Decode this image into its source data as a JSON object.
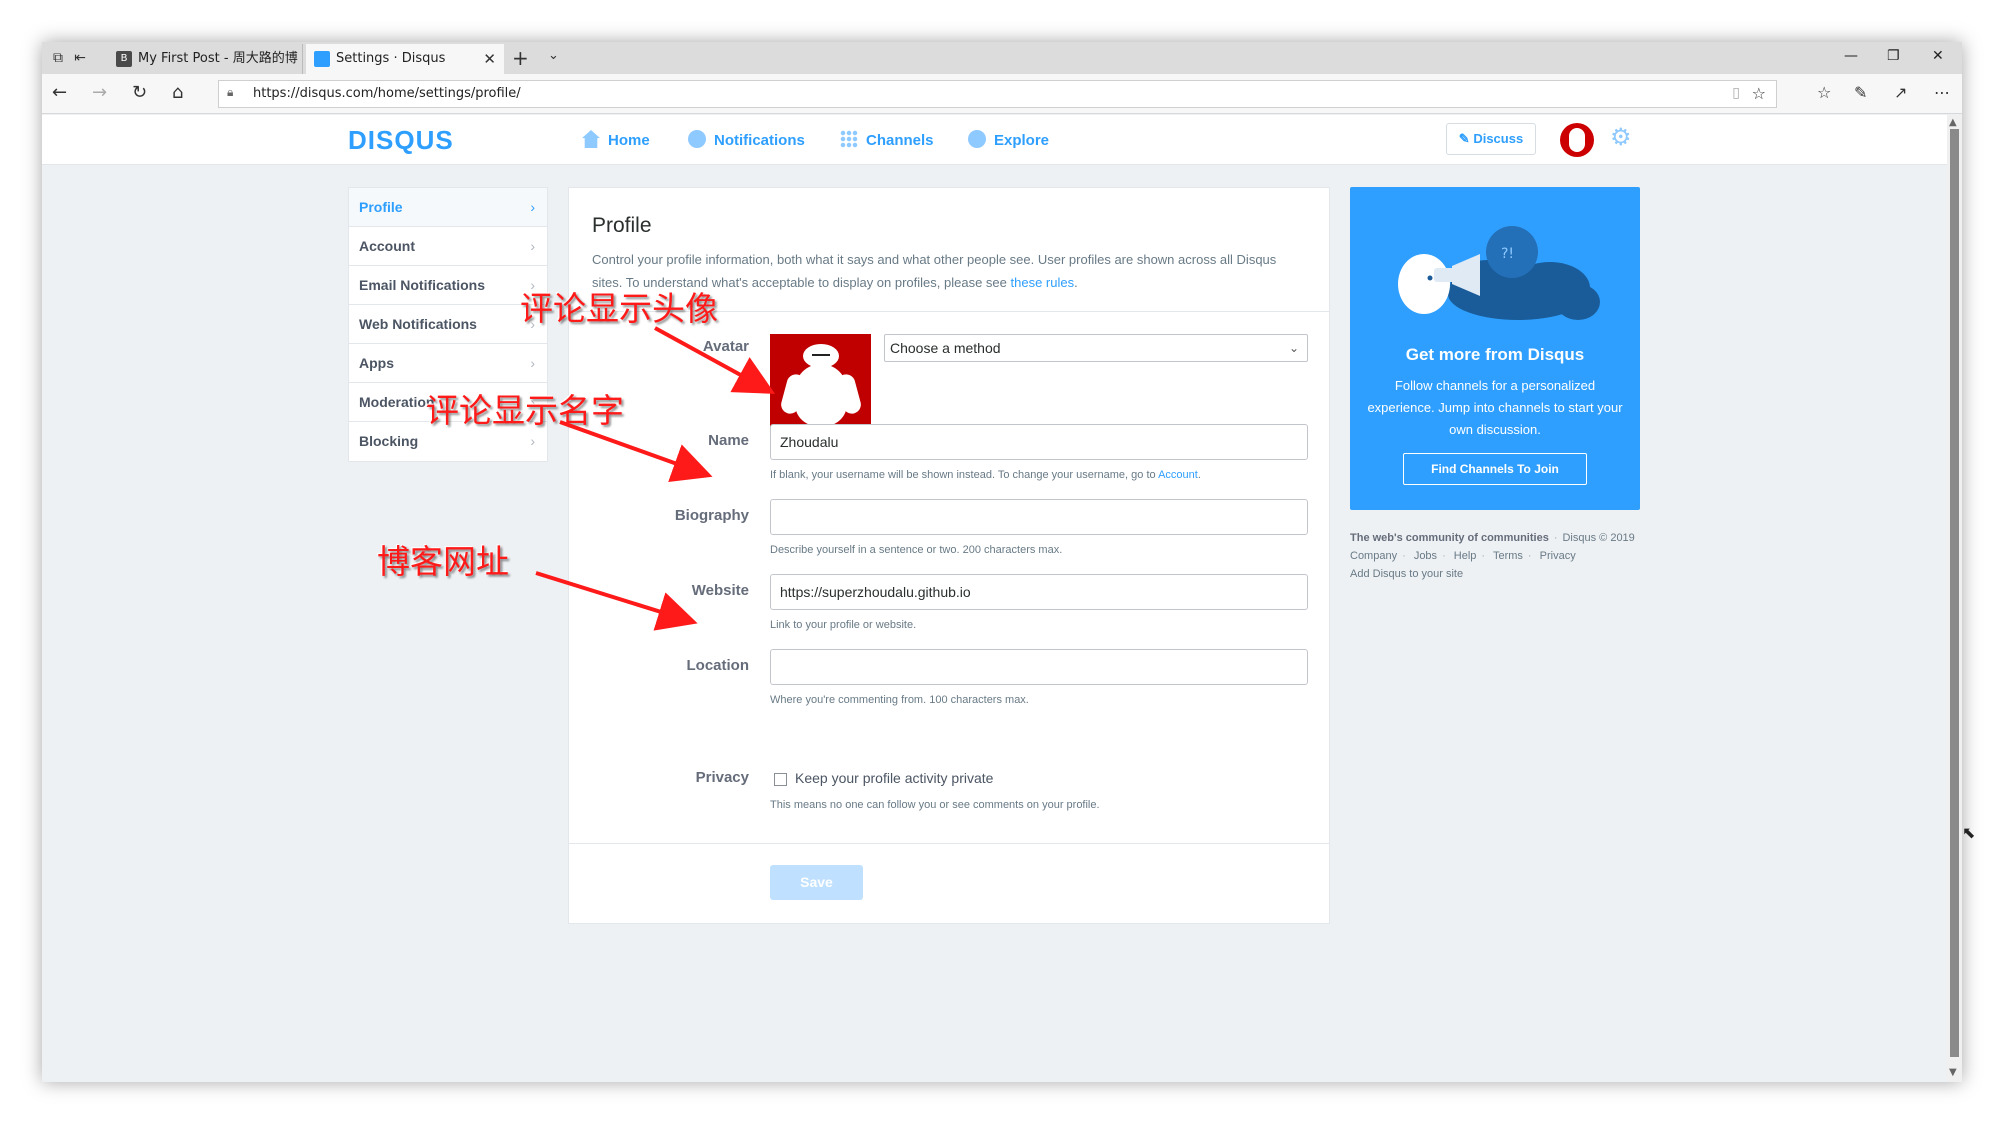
{
  "browser": {
    "tabs": [
      {
        "title": "My First Post - 周大路的博",
        "active": false,
        "favicon": "B"
      },
      {
        "title": "Settings · Disqus",
        "active": true
      }
    ],
    "url": "https://disqus.com/home/settings/profile/"
  },
  "header": {
    "logo": "DISQUS",
    "nav": [
      {
        "label": "Home",
        "icon": "home-icon"
      },
      {
        "label": "Notifications",
        "icon": "notifications-icon"
      },
      {
        "label": "Channels",
        "icon": "channels-icon"
      },
      {
        "label": "Explore",
        "icon": "explore-icon"
      }
    ],
    "discuss_label": "Discuss"
  },
  "sidebar": {
    "items": [
      {
        "label": "Profile",
        "active": true
      },
      {
        "label": "Account"
      },
      {
        "label": "Email Notifications"
      },
      {
        "label": "Web Notifications"
      },
      {
        "label": "Apps"
      },
      {
        "label": "Moderation"
      },
      {
        "label": "Blocking"
      }
    ]
  },
  "profile": {
    "title": "Profile",
    "description": "Control your profile information, both what it says and what other people see. User profiles are shown across all Disqus sites. To understand what's acceptable to display on profiles, please see ",
    "rules_link": "these rules",
    "avatar_label": "Avatar",
    "avatar_method": "Choose a method",
    "name_label": "Name",
    "name_value": "Zhoudalu",
    "name_help": "If blank, your username will be shown instead. To change your username, go to ",
    "name_help_link": "Account",
    "bio_label": "Biography",
    "bio_value": "",
    "bio_help": "Describe yourself in a sentence or two. 200 characters max.",
    "website_label": "Website",
    "website_value": "https://superzhoudalu.github.io",
    "website_help": "Link to your profile or website.",
    "location_label": "Location",
    "location_value": "",
    "location_help": "Where you're commenting from. 100 characters max.",
    "privacy_label": "Privacy",
    "privacy_checkbox": "Keep your profile activity private",
    "privacy_checked": false,
    "privacy_help": "This means no one can follow you or see comments on your profile.",
    "save_label": "Save"
  },
  "promo": {
    "title": "Get more from Disqus",
    "text": "Follow channels for a personalized experience. Jump into channels to start your own discussion.",
    "button": "Find Channels To Join"
  },
  "footer": {
    "tagline": "The web's community of communities",
    "copyright": "Disqus © 2019",
    "links": [
      "Company",
      "Jobs",
      "Help",
      "Terms",
      "Privacy"
    ],
    "add": "Add Disqus to your site"
  },
  "annotations": {
    "avatar": "评论显示头像",
    "name": "评论显示名字",
    "website": "博客网址"
  },
  "colors": {
    "accent": "#2e9fff",
    "annotation": "#ff1a1a",
    "avatar_bg": "#c00000"
  }
}
